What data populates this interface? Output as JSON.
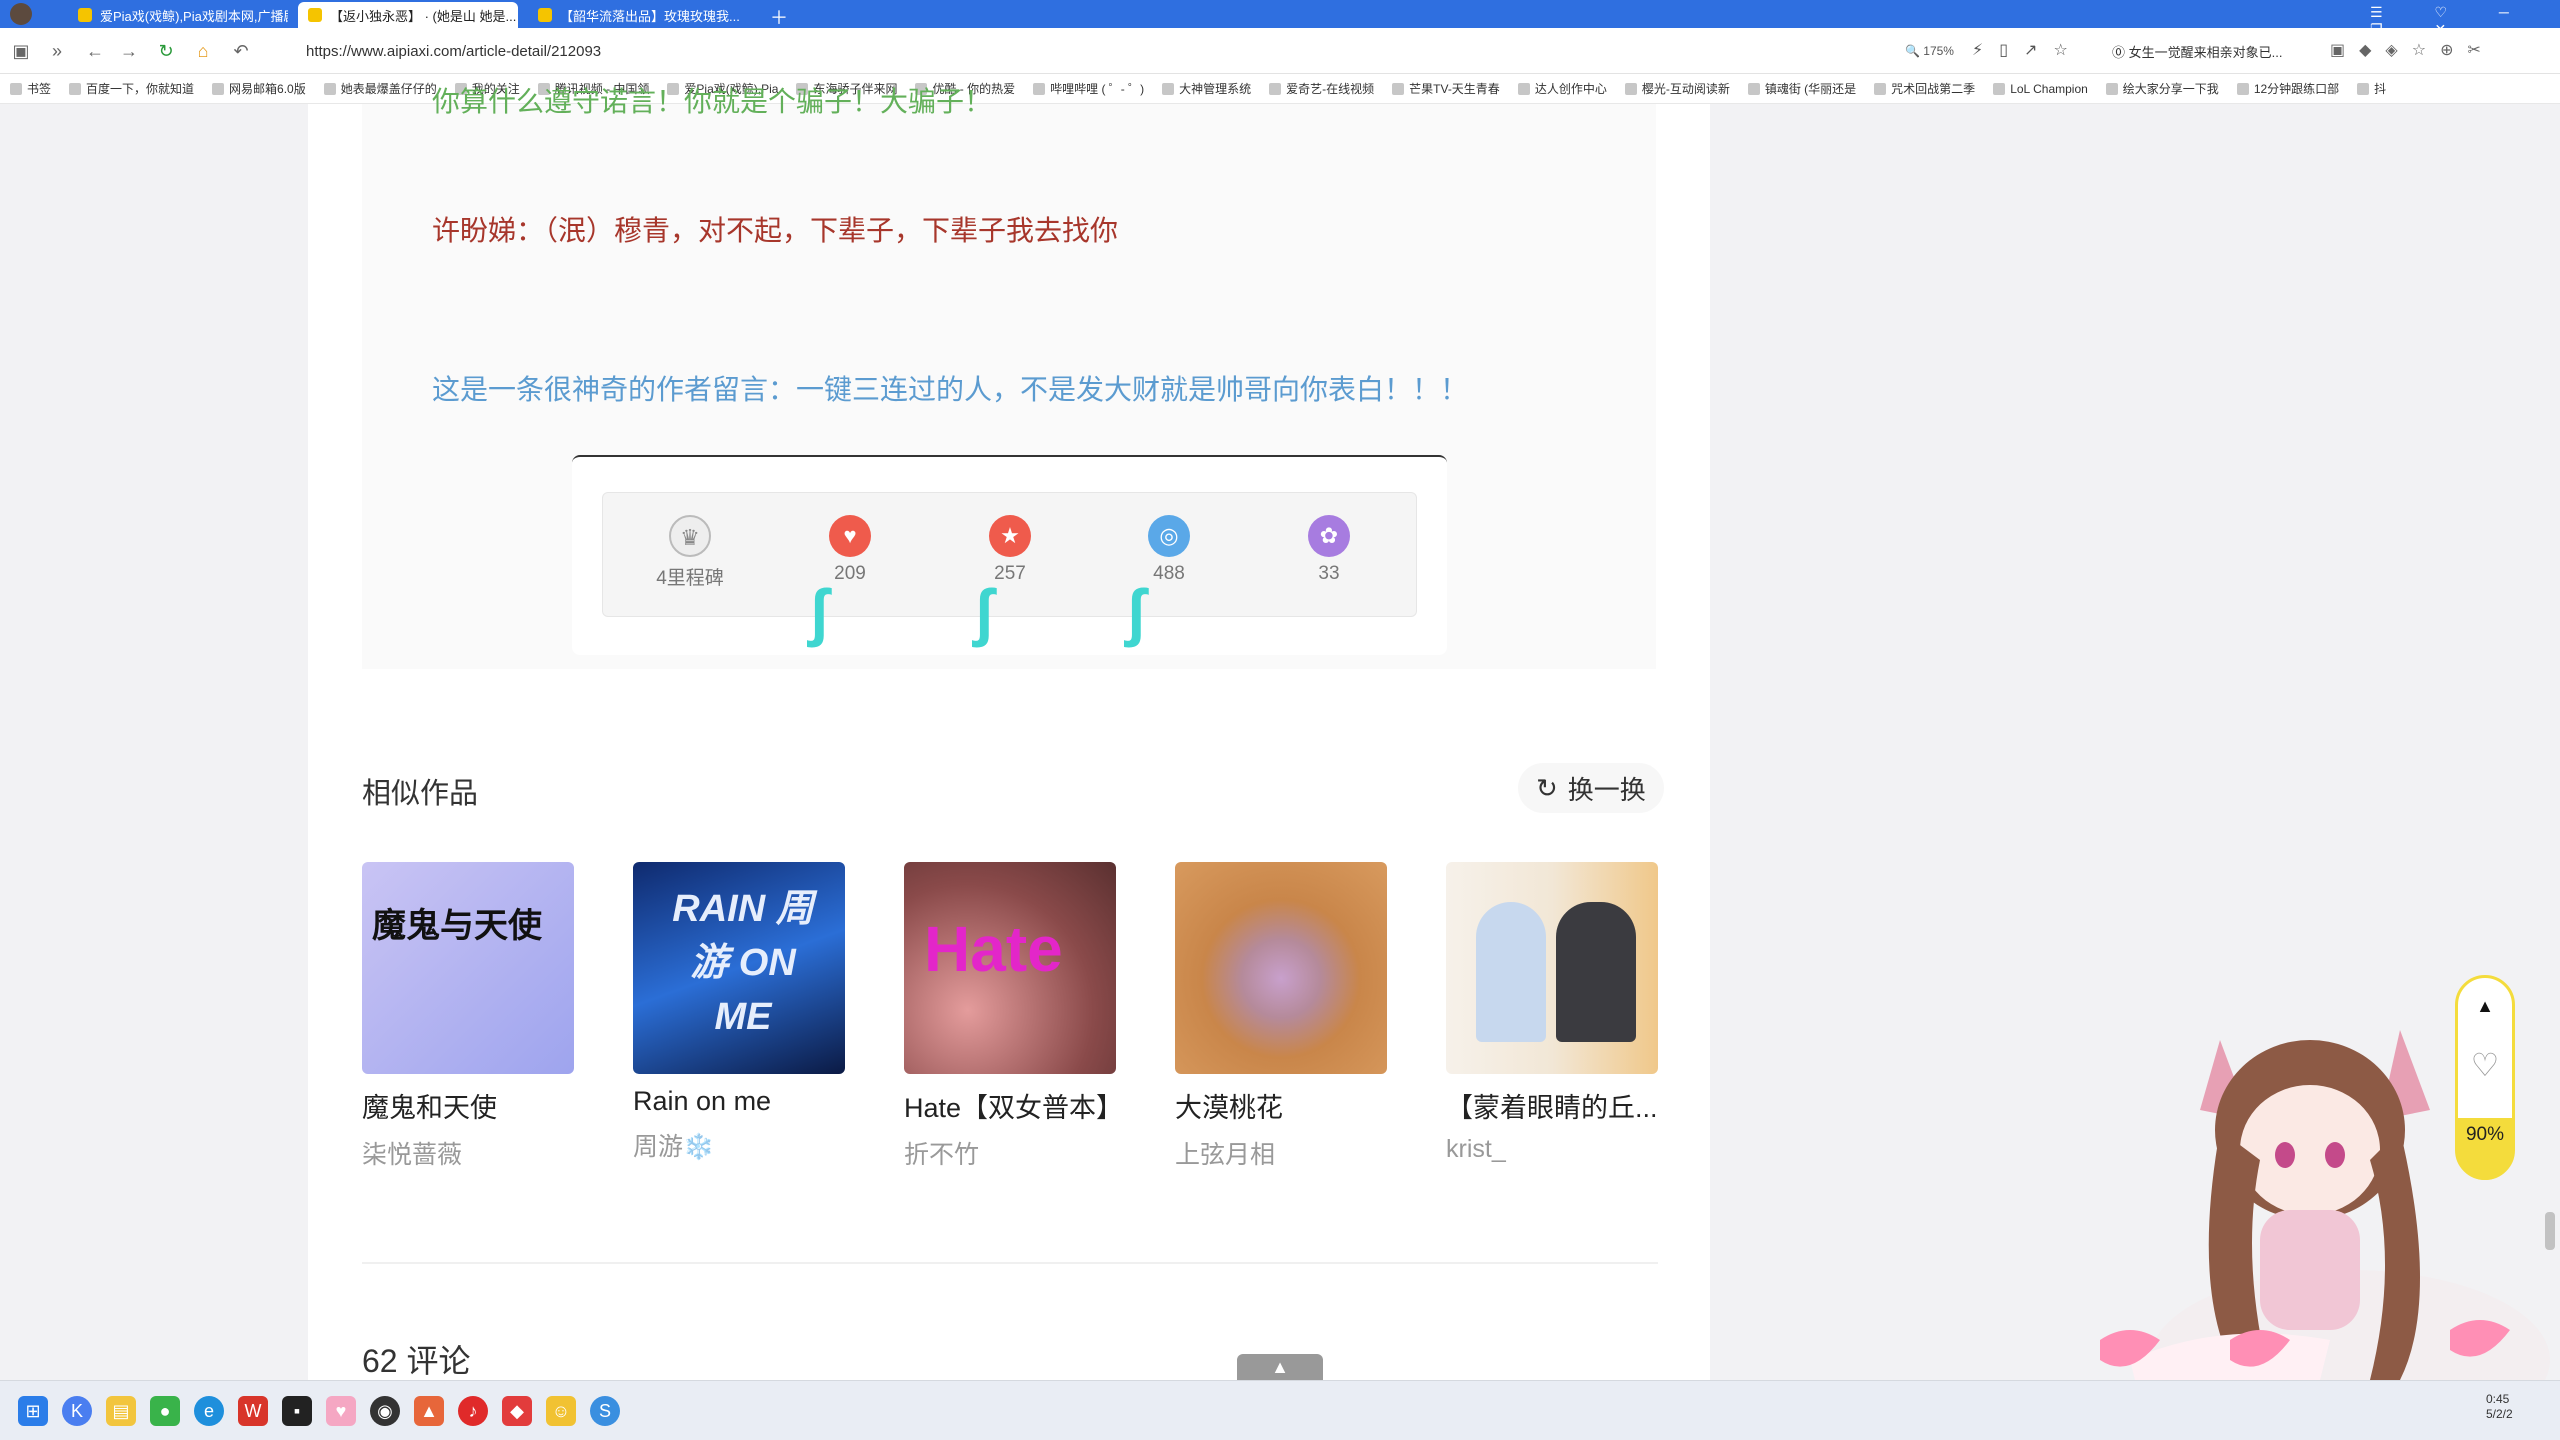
{
  "browser": {
    "tabs": [
      {
        "title": "爱Pia戏(戏鲸),Pia戏剧本网,广播剧..."
      },
      {
        "title": "【返小独永恶】 · (她是山 她是..."
      },
      {
        "title": "【韶华流落出品】玫瑰玫瑰我..."
      }
    ],
    "url": "https://www.aipiaxi.com/article-detail/212093",
    "zoom": "175%",
    "search_hint": "女生一觉醒来相亲对象已...",
    "bookmarks": [
      "书签",
      "百度一下，你就知道",
      "网易邮箱6.0版",
      "她表最爆盖仔仔的",
      "我的关注",
      "腾讯视频 - 中国领",
      "爱Pia戏(戏鲸),Pia",
      "东海骄子伴来网",
      "优酷 - 你的热爱",
      "哔哩哔哩 ( ゜- ゜)",
      "大神管理系统",
      "爱奇艺-在线视频",
      "芒果TV-天生青春",
      "达人创作中心",
      "樱光-互动阅读新",
      "镇魂街 (华丽还是",
      "咒术回战第二季",
      "LoL Champion",
      "绘大家分享一下我",
      "12分钟跟练口部",
      "抖"
    ]
  },
  "article": {
    "green_line_1": "你算什么遵守诺言！你就是个骗子！大骗子！",
    "red_line": "许盼娣：（泯）穆青，对不起，下辈子，下辈子我去找你",
    "blue_note": "这是一条很神奇的作者留言：一键三连过的人，不是发大财就是帅哥向你表白！！！"
  },
  "reward_bar": {
    "items": [
      {
        "icon": "crown-icon",
        "label": "4里程碑"
      },
      {
        "icon": "heart-icon",
        "label": "209"
      },
      {
        "icon": "star-icon",
        "label": "257"
      },
      {
        "icon": "coin-icon",
        "label": "488"
      },
      {
        "icon": "gift-icon",
        "label": "33"
      }
    ]
  },
  "similar": {
    "title": "相似作品",
    "refresh_label": "换一换",
    "cards": [
      {
        "title": "魔鬼和天使",
        "author": "柒悦蔷薇",
        "cover_text": "魔鬼与天使"
      },
      {
        "title": "Rain on me",
        "author": "周游❄️",
        "cover_text": "RAIN 周游 ON ME"
      },
      {
        "title": "Hate【双女普本】",
        "author": "折不竹",
        "cover_text": "Hate"
      },
      {
        "title": "大漠桃花",
        "author": "上弦月相",
        "cover_text": ""
      },
      {
        "title": "【蒙着眼睛的丘...",
        "author": "krist_",
        "cover_text": ""
      }
    ]
  },
  "comments": {
    "title": "62 评论"
  },
  "float_widget": {
    "percent": "90%"
  },
  "taskbar": {
    "time": "0:45",
    "date": "5/2/2"
  },
  "colors": {
    "green": "#63b05a",
    "red": "#a7362b",
    "blue": "#5b9bd0",
    "browser_blue": "#2f6fe0"
  }
}
